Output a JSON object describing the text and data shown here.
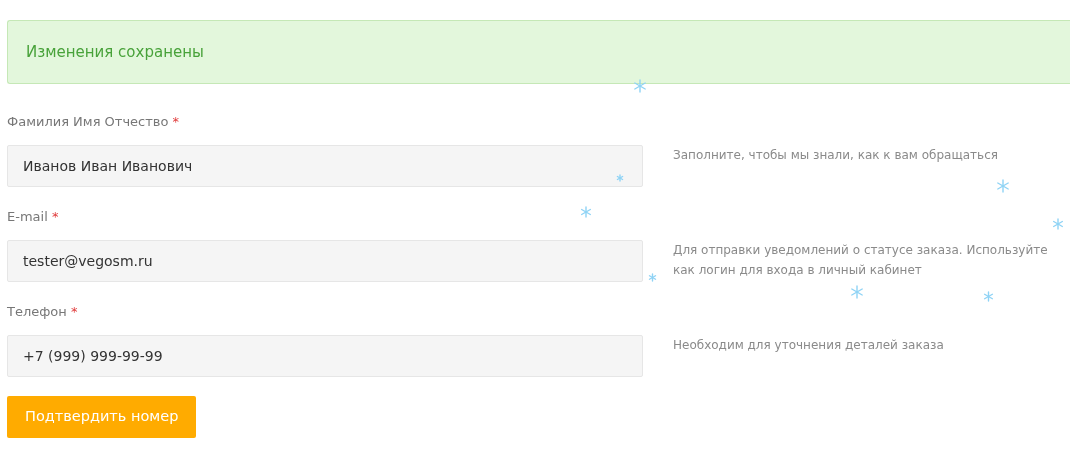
{
  "alert": {
    "text": "Изменения сохранены"
  },
  "fields": [
    {
      "label": "Фамилия Имя Отчество",
      "required_mark": "*",
      "value": "Иванов Иван Иванович",
      "hint": "Заполните, чтобы мы знали, как к вам обращаться"
    },
    {
      "label": "E-mail",
      "required_mark": "*",
      "value": "tester@vegosm.ru",
      "hint": "Для отправки уведомлений о статусе заказа. Используйте как логин для входа в личный кабинет"
    },
    {
      "label": "Телефон",
      "required_mark": "*",
      "value": "+7 (999) 999-99-99",
      "hint": "Необходим для уточнения деталей заказа"
    }
  ],
  "button": {
    "label": "Подтвердить номер"
  }
}
